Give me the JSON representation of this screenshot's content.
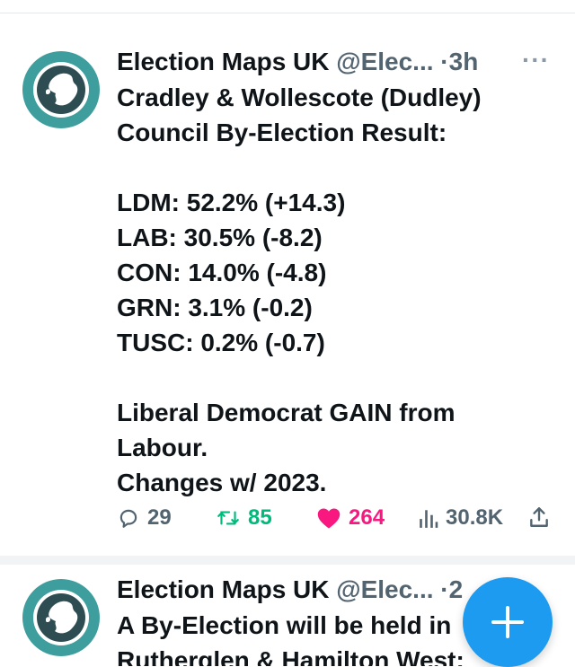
{
  "tweets": [
    {
      "author": "Election Maps UK",
      "handle": "@Elec...",
      "sep": "·",
      "time": "3h",
      "more_label": "···",
      "lines": [
        "Cradley & Wollescote (Dudley)",
        "Council By-Election Result:",
        "",
        "LDM: 52.2% (+14.3)",
        "LAB: 30.5% (-8.2)",
        "CON: 14.0% (-4.8)",
        "GRN: 3.1% (-0.2)",
        "TUSC: 0.2% (-0.7)",
        "",
        "Liberal Democrat GAIN from",
        "Labour.",
        "Changes w/ 2023."
      ],
      "metrics": {
        "replies": "29",
        "retweets": "85",
        "likes": "264",
        "views": "30.8K"
      }
    },
    {
      "author": "Election Maps UK",
      "handle": "@Elec...",
      "sep": "·",
      "time": "2",
      "more_label": "···",
      "lines": [
        "A By-Election will be held in",
        "Rutherglen & Hamilton West:"
      ]
    }
  ],
  "colors": {
    "avatar_bg": "#3e9e9d",
    "retweet": "#00ba7c",
    "like": "#f91880",
    "fab": "#1d9bf0",
    "muted": "#536471"
  },
  "icons": {
    "reply": "reply-icon",
    "retweet": "retweet-icon",
    "like": "heart-icon",
    "views": "views-icon",
    "share": "share-icon",
    "compose": "plus-icon"
  }
}
